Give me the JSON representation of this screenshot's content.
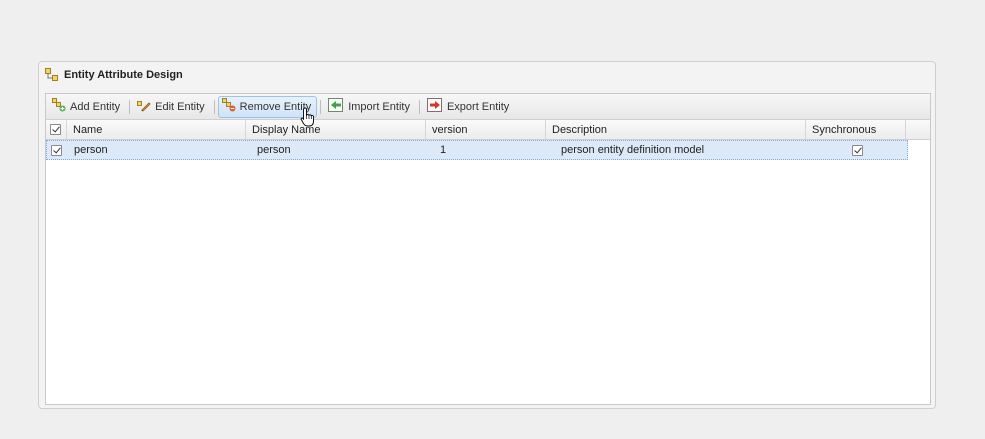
{
  "panel": {
    "title": "Entity Attribute Design"
  },
  "toolbar": {
    "add_label": "Add Entity",
    "edit_label": "Edit Entity",
    "remove_label": "Remove Entity",
    "import_label": "Import Entity",
    "export_label": "Export Entity"
  },
  "grid": {
    "columns": [
      "Name",
      "Display Name",
      "version",
      "Description",
      "Synchronous"
    ],
    "rows": [
      {
        "name": "person",
        "display_name": "person",
        "version": "1",
        "description": "person entity definition model",
        "synchronous": true,
        "selected": true
      }
    ]
  },
  "colors": {
    "row_selected": "#dce9f8",
    "hover_border": "#9ec3ea"
  }
}
